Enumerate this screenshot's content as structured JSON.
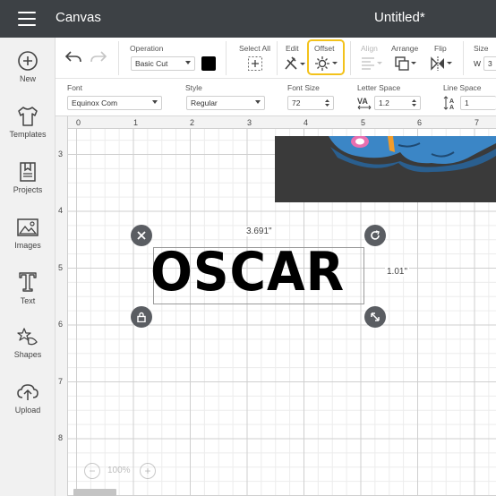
{
  "header": {
    "app_title": "Canvas",
    "doc_title": "Untitled*"
  },
  "sidebar": {
    "items": [
      {
        "label": "New",
        "icon": "plus-icon"
      },
      {
        "label": "Templates",
        "icon": "shirt-icon"
      },
      {
        "label": "Projects",
        "icon": "bookmark-icon"
      },
      {
        "label": "Images",
        "icon": "image-icon"
      },
      {
        "label": "Text",
        "icon": "text-icon"
      },
      {
        "label": "Shapes",
        "icon": "shapes-icon"
      },
      {
        "label": "Upload",
        "icon": "upload-icon"
      }
    ]
  },
  "toolbar": {
    "operation_label": "Operation",
    "operation_value": "Basic Cut",
    "select_all_label": "Select All",
    "edit_label": "Edit",
    "offset_label": "Offset",
    "align_label": "Align",
    "arrange_label": "Arrange",
    "flip_label": "Flip",
    "size_label": "Size",
    "size_w_label": "W",
    "size_w_value": "3",
    "swatch_color": "#000000",
    "highlight_color": "#f3c21b"
  },
  "text_toolbar": {
    "font_label": "Font",
    "font_value": "Equinox Com",
    "style_label": "Style",
    "style_value": "Regular",
    "font_size_label": "Font Size",
    "font_size_value": "72",
    "letter_space_label": "Letter Space",
    "letter_space_value": "1.2",
    "line_space_label": "Line Space",
    "line_space_value": "1"
  },
  "canvas": {
    "ruler_top": [
      "0",
      "1",
      "2",
      "3",
      "4",
      "5",
      "6",
      "7"
    ],
    "ruler_left": [
      "3",
      "4",
      "5",
      "6",
      "7",
      "8"
    ],
    "text_content": "OSCAR",
    "width_label": "3.691\"",
    "height_label": "1.01\"",
    "zoom_value": "100%",
    "zoom_minus": "−",
    "zoom_plus": "+"
  }
}
